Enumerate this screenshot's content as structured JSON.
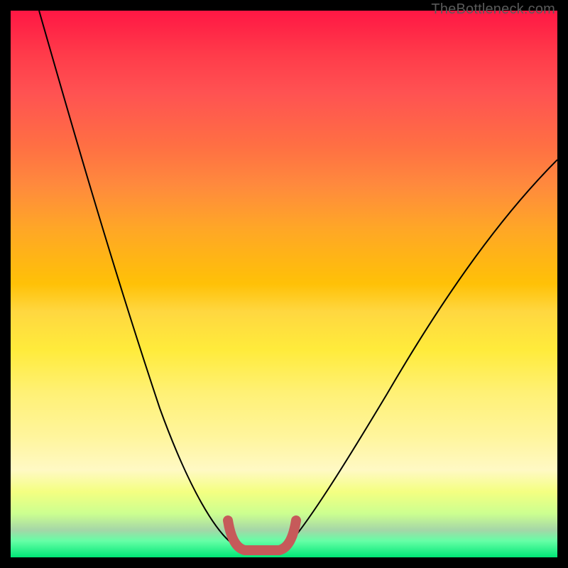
{
  "watermark": "TheBottleneck.com",
  "chart_data": {
    "type": "line",
    "title": "",
    "xlabel": "",
    "ylabel": "",
    "xlim": [
      0,
      100
    ],
    "ylim": [
      0,
      100
    ],
    "series": [
      {
        "name": "bottleneck-curve",
        "x": [
          5,
          10,
          15,
          20,
          25,
          30,
          35,
          40,
          42,
          45,
          48,
          50,
          55,
          60,
          65,
          70,
          75,
          80,
          85,
          90,
          95,
          100
        ],
        "y": [
          100,
          86,
          72,
          59,
          47,
          36,
          26,
          12,
          6,
          2,
          2,
          6,
          12,
          22,
          30,
          38,
          45,
          51,
          57,
          62,
          67,
          72
        ]
      }
    ],
    "annotations": [
      {
        "name": "highlight-band",
        "shape": "u",
        "x_range": [
          40,
          50
        ],
        "y": 2,
        "color": "#c65a5a"
      }
    ],
    "gradient_background": {
      "top": "#ff1744",
      "bottom": "#00e676",
      "meaning": "red-high-bottleneck-to-green-low-bottleneck"
    }
  }
}
